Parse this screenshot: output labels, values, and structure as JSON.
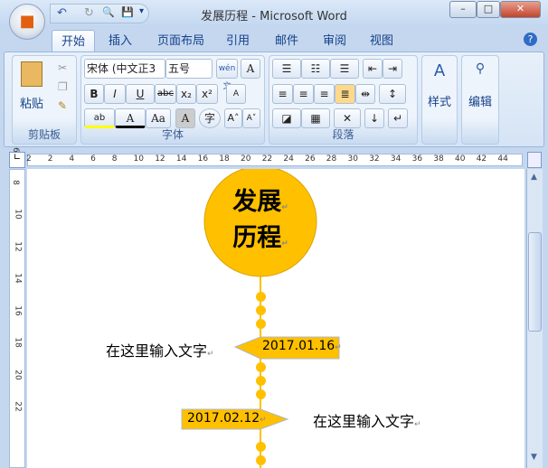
{
  "window": {
    "title": "发展历程 - Microsoft Word",
    "minimize": "–",
    "restore": "□",
    "close": "✕"
  },
  "quick_access": {
    "undo": "↶",
    "redo": "↻",
    "preview": "🔍",
    "save": "💾",
    "customize": "▾"
  },
  "tabs": [
    "开始",
    "插入",
    "页面布局",
    "引用",
    "邮件",
    "审阅",
    "视图"
  ],
  "help": "?",
  "ribbon": {
    "clipboard": {
      "label": "剪贴板",
      "paste": "粘贴"
    },
    "font": {
      "label": "字体",
      "font_name": "宋体 (中文正3",
      "font_size": "五号",
      "phonetic": "wén文",
      "border_char": "A",
      "bold": "B",
      "italic": "I",
      "underline": "U",
      "strike": "abc",
      "subscript": "x₂",
      "superscript": "x²",
      "clear": "A",
      "highlight": "ab",
      "font_color": "A",
      "case": "Aa",
      "shading": "A",
      "enclose": "字",
      "grow": "A˄",
      "shrink": "A˅"
    },
    "paragraph": {
      "label": "段落"
    },
    "styles": {
      "label": "样式"
    },
    "editing": {
      "label": "编辑"
    }
  },
  "ruler": {
    "h_ticks": [
      "2",
      "2",
      "4",
      "6",
      "8",
      "10",
      "12",
      "14",
      "16",
      "18",
      "20",
      "22",
      "24",
      "26",
      "28",
      "30",
      "32",
      "34",
      "36",
      "38",
      "40",
      "42",
      "44"
    ],
    "v_ticks": [
      "6",
      "8",
      "10",
      "12",
      "14",
      "16",
      "18",
      "20",
      "22"
    ]
  },
  "document": {
    "title_line1": "发展",
    "title_line2": "历程",
    "events": [
      {
        "date": "2017.01.16",
        "text": "在这里输入文字"
      },
      {
        "date": "2017.02.12",
        "text": "在这里输入文字"
      }
    ],
    "para_mark": "↵"
  },
  "colors": {
    "accent": "#ffc000"
  }
}
